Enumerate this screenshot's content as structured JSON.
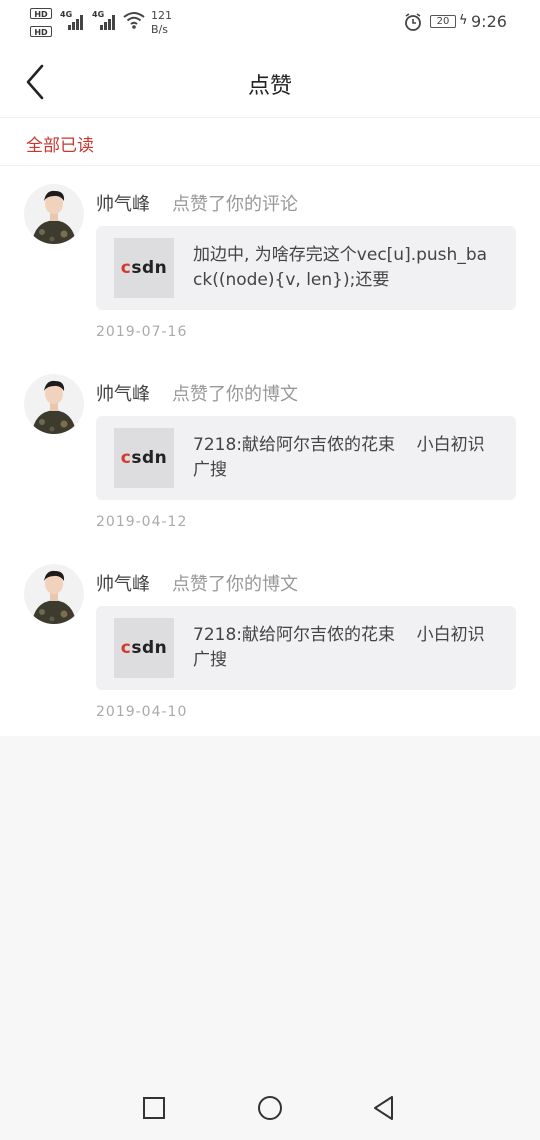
{
  "status_bar": {
    "hd_badges": [
      "HD",
      "HD"
    ],
    "network_1": "4G",
    "network_2": "4G",
    "speed_value": "121",
    "speed_unit": "B/s",
    "battery_level": "20",
    "time": "9:26",
    "icons": [
      "signal-icon",
      "wifi-icon",
      "alarm-icon",
      "battery-icon",
      "charging-icon"
    ]
  },
  "header": {
    "title": "点赞",
    "back_icon": "back-chevron-icon"
  },
  "mark_all_read": "全部已读",
  "accent_color": "#c8372d",
  "notifications": [
    {
      "user": "帅气峰",
      "action": "点赞了你的评论",
      "thumb_logo": "CSDN",
      "text": "加边中, 为啥存完这个vec[u].push_back((node){v, len});还要",
      "date": "2019-07-16"
    },
    {
      "user": "帅气峰",
      "action": "点赞了你的博文",
      "thumb_logo": "CSDN",
      "text": "7218:献给阿尔吉侬的花束    小白初识广搜",
      "date": "2019-04-12"
    },
    {
      "user": "帅气峰",
      "action": "点赞了你的博文",
      "thumb_logo": "CSDN",
      "text": "7218:献给阿尔吉侬的花束    小白初识广搜",
      "date": "2019-04-10"
    }
  ],
  "nav_bar": {
    "buttons": [
      "recents-square-icon",
      "home-circle-icon",
      "back-triangle-icon"
    ]
  }
}
